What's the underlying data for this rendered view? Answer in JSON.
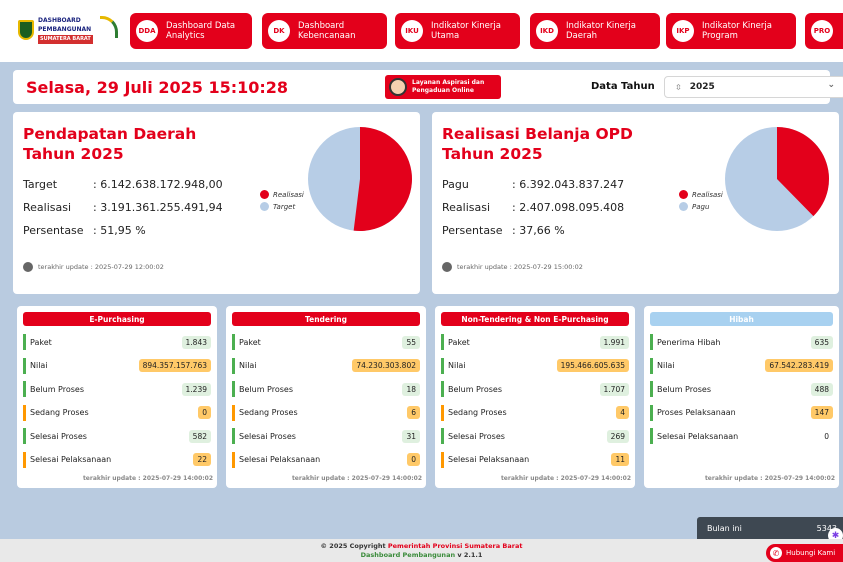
{
  "logo": {
    "line1": "DASHBOARD",
    "line2": "PEMBANGUNAN",
    "line3": "SUMATERA BARAT"
  },
  "nav": [
    {
      "abbr": "DDA",
      "label": "Dashboard Data Analytics"
    },
    {
      "abbr": "DK",
      "label": "Dashboard Kebencanaan"
    },
    {
      "abbr": "IKU",
      "label": "Indikator Kinerja Utama"
    },
    {
      "abbr": "IKD",
      "label": "Indikator Kinerja Daerah"
    },
    {
      "abbr": "IKP",
      "label": "Indikator Kinerja Program"
    },
    {
      "abbr": "PRO",
      "label": ""
    }
  ],
  "datebar": {
    "datetime": "Selasa, 29 Juli 2025  15:10:28",
    "aspirasi": "Layanan Aspirasi dan Pengaduan Online",
    "tahun_label": "Data Tahun",
    "tahun_value": "2025"
  },
  "pendapatan": {
    "title": "Pendapatan Daerah Tahun 2025",
    "rows": [
      {
        "k": "Target",
        "v": ": 6.142.638.172.948,00"
      },
      {
        "k": "Realisasi",
        "v": ": 3.191.361.255.491,94"
      },
      {
        "k": "Persentase",
        "v": ": 51,95 %"
      }
    ],
    "update": "terakhir update : 2025-07-29 12:00:02",
    "legend": [
      "Realisasi",
      "Target"
    ],
    "pie_fraction": 0.5195
  },
  "belanja": {
    "title": "Realisasi Belanja OPD Tahun 2025",
    "rows": [
      {
        "k": "Pagu",
        "v": ": 6.392.043.837.247"
      },
      {
        "k": "Realisasi",
        "v": ": 2.407.098.095.408"
      },
      {
        "k": "Persentase",
        "v": ": 37,66 %"
      }
    ],
    "update": "terakhir update : 2025-07-29 15:00:02",
    "legend": [
      "Realisasi",
      "Pagu"
    ],
    "pie_fraction": 0.3766
  },
  "cards": [
    {
      "title": "E-Purchasing",
      "rows": [
        {
          "k": "Paket",
          "v": "1.843"
        },
        {
          "k": "Nilai",
          "v": "894.357.157.763"
        },
        {
          "k": "Belum Proses",
          "v": "1.239"
        },
        {
          "k": "Sedang Proses",
          "v": "0"
        },
        {
          "k": "Selesai Proses",
          "v": "582"
        },
        {
          "k": "Selesai Pelaksanaan",
          "v": "22"
        }
      ],
      "foot": "terakhir update : 2025-07-29 14:00:02"
    },
    {
      "title": "Tendering",
      "rows": [
        {
          "k": "Paket",
          "v": "55"
        },
        {
          "k": "Nilai",
          "v": "74.230.303.802"
        },
        {
          "k": "Belum Proses",
          "v": "18"
        },
        {
          "k": "Sedang Proses",
          "v": "6"
        },
        {
          "k": "Selesai Proses",
          "v": "31"
        },
        {
          "k": "Selesai Pelaksanaan",
          "v": "0"
        }
      ],
      "foot": "terakhir update : 2025-07-29 14:00:02"
    },
    {
      "title": "Non-Tendering & Non E-Purchasing",
      "rows": [
        {
          "k": "Paket",
          "v": "1.991"
        },
        {
          "k": "Nilai",
          "v": "195.466.605.635"
        },
        {
          "k": "Belum Proses",
          "v": "1.707"
        },
        {
          "k": "Sedang Proses",
          "v": "4"
        },
        {
          "k": "Selesai Proses",
          "v": "269"
        },
        {
          "k": "Selesai Pelaksanaan",
          "v": "11"
        }
      ],
      "foot": "terakhir update : 2025-07-29 14:00:02"
    },
    {
      "title": "Hibah",
      "rows": [
        {
          "k": "Penerima Hibah",
          "v": "635"
        },
        {
          "k": "Nilai",
          "v": "67.542.283.419"
        },
        {
          "k": "Belum Proses",
          "v": "488"
        },
        {
          "k": "Proses Pelaksanaan",
          "v": "147"
        },
        {
          "k": "Selesai Pelaksanaan",
          "v": "0"
        }
      ],
      "foot": "terakhir update : 2025-07-29 14:00:02"
    }
  ],
  "bulan": {
    "label": "Bulan ini",
    "value": "5343"
  },
  "footer": {
    "prefix": "© 2025 Copyright ",
    "org": "Pemerintah Provinsi Sumatera Barat",
    "app": "Dashboard Pembangunan",
    "version": " v 2.1.1"
  },
  "hubungi": "Hubungi Kami",
  "colors": {
    "accent": "#e3001b",
    "pie_light": "#b7cde6",
    "hibah": "#a8d1f0"
  }
}
